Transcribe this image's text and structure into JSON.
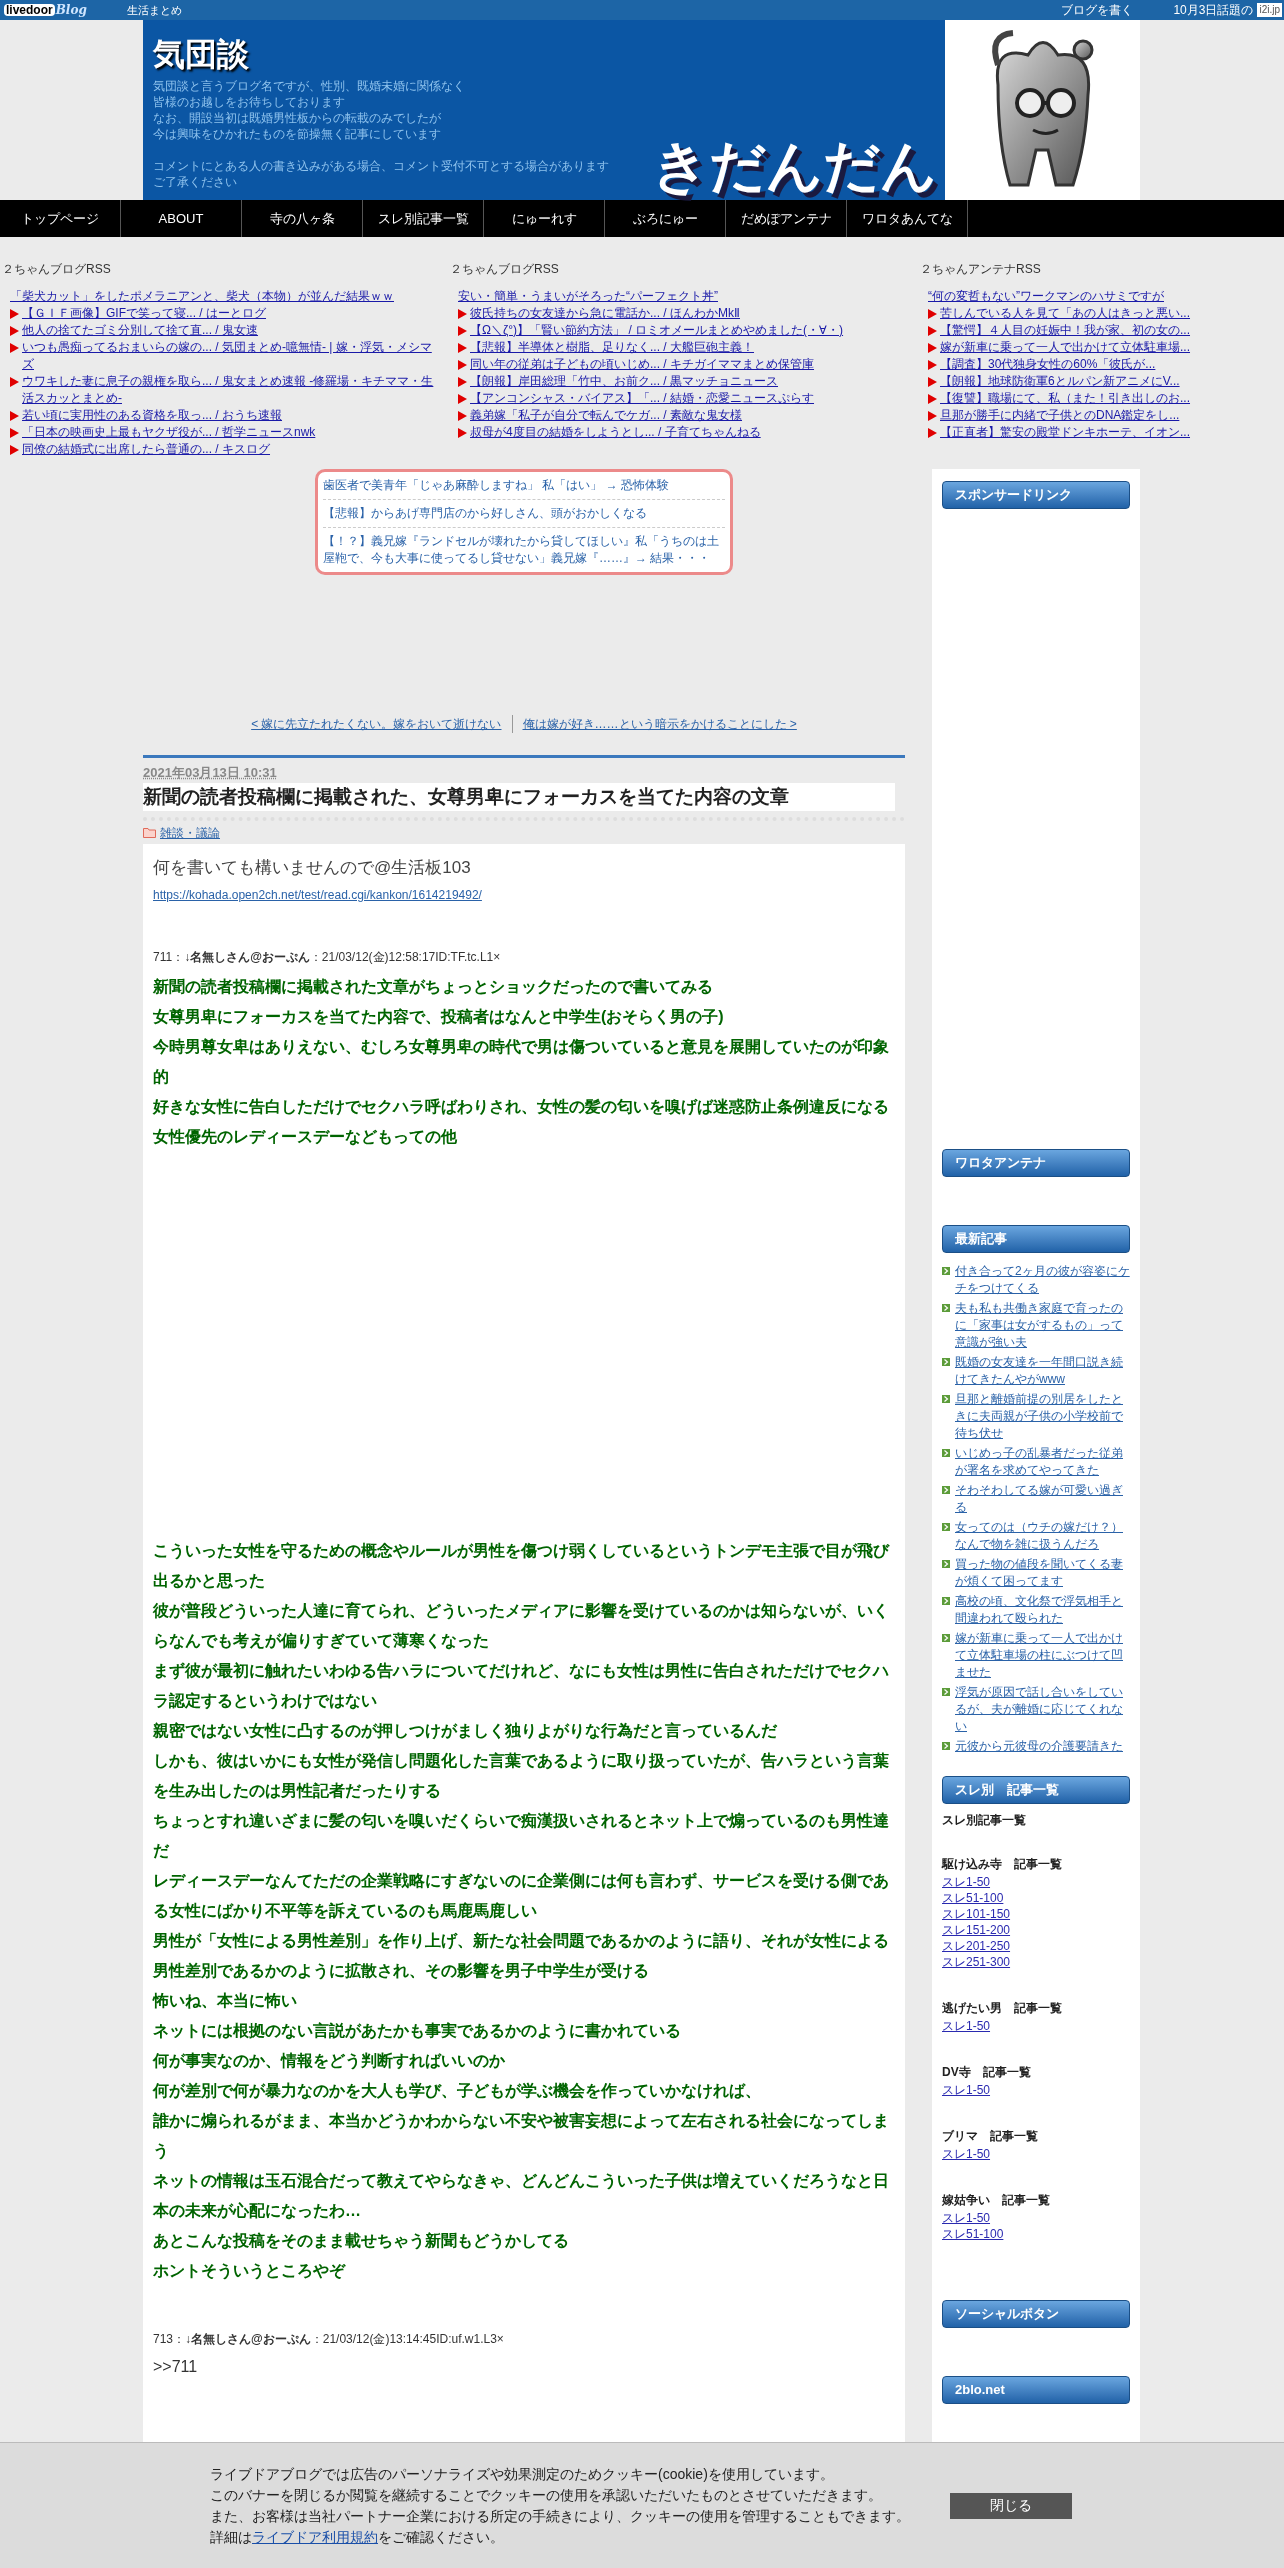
{
  "top_bar": {
    "logo": "livedoor",
    "logo_script": "Blog",
    "category": "生活まとめ",
    "links": [
      "ブログを書く",
      "10月3日話題の"
    ],
    "badge": "i2i.jp"
  },
  "header": {
    "title": "気団談",
    "description": [
      [
        "気団談と言うブログ名ですが、性別、既婚未婚に関係なく",
        "皆様のお越しをお待ちしております",
        "なお、開設当初は既婚男性板からの転載のみでしたが",
        "今は興味をひかれたものを節操無く記事にしています"
      ],
      [
        "コメントにとある人の書き込みがある場合、コメント受付不可とする場合があります",
        "ご了承ください"
      ]
    ],
    "banner_text": "きだんだん"
  },
  "nav": [
    "トップページ",
    "ABOUT",
    "寺の八ヶ条",
    "スレ別記事一覧",
    "にゅーれす",
    "ぶろにゅー",
    "だめぽアンテナ",
    "ワロタあんてな"
  ],
  "rss": [
    {
      "title": "２ちゃんブログRSS",
      "headline": "「柴犬カット」をしたポメラニアンと、柴犬（本物）が並んだ結果ｗｗ",
      "items": [
        "【ＧＩＦ画像】GIFで笑って寝... / はーとログ",
        "他人の捨てたゴミ分別して捨て直... / 鬼女速",
        "いつも愚痴ってるおまいらの嫁の... / 気団まとめ-噫無情- | 嫁・浮気・メシマズ",
        "ウワキした妻に息子の親権を取ら... / 鬼女まとめ速報 -修羅場・キチママ・生活スカッとまとめ-",
        "若い頃に実用性のある資格を取っ... / おうち速報",
        "「日本の映画史上最もヤクザ役が... / 哲学ニュースnwk",
        "同僚の結婚式に出席したら普通の... / キスログ"
      ]
    },
    {
      "title": "２ちゃんブログRSS",
      "headline": "安い・簡単・うまいがそろった“パーフェクト丼”",
      "items": [
        "彼氏持ちの女友達から急に電話か... / ほんわかMkⅡ",
        "【Ω＼ζ°)】「賢い節約方法」 / ロミオメールまとめやめました(・∀・)",
        "【悲報】半導体と樹脂、足りなく... / 大艦巨砲主義！",
        "同い年の従弟は子どもの頃いじめ... / キチガイママまとめ保管庫",
        "【朗報】岸田総理「竹中、お前ク... / 黒マッチョニュース",
        "【アンコンシャス・バイアス】「... / 結婚・恋愛ニュースぷらす",
        "義弟嫁「私子が自分で転んでケガ... / 素敵な鬼女様",
        "叔母が4度目の結婚をしようとし... / 子育てちゃんねる"
      ]
    },
    {
      "title": "２ちゃんアンテナRSS",
      "headline": "“何の変哲もない”ワークマンのハサミですが",
      "items": [
        "苦しんでいる人を見て「あの人はきっと悪い...",
        "【驚愕】４人目の妊娠中！我が家、初の女の...",
        "嫁が新車に乗って一人で出かけて立体駐車場...",
        "【調査】30代独身女性の60%「彼氏が...",
        "【朗報】地球防衛軍6とルパン新アニメにV...",
        "【復讐】職場にて、私（また！引き出しのお...",
        "旦那が勝手に内緒で子供とのDNA鑑定をし...",
        "【正直者】驚安の殿堂ドンキホーテ、イオン..."
      ]
    }
  ],
  "popular": [
    "歯医者で美青年「じゃあ麻酔しますね」 私「はい」 → 恐怖体験",
    "【悲報】からあげ専門店のから好しさん、頭がおかしくなる",
    "【！？】義兄嫁『ランドセルが壊れたから貸してほしい』私「うちのは土屋鞄で、今も大事に使ってるし貸せない」義兄嫁『……』→ 結果・・・"
  ],
  "post_nav": {
    "prev": "< 嫁に先立たれたくない。嫁をおいて逝けない",
    "next": "俺は嫁が好き……という暗示をかけることにした >"
  },
  "article": {
    "date": "2021年03月13日 10:31",
    "title": "新聞の読者投稿欄に掲載された、女尊男卑にフォーカスを当てた内容の文章",
    "category": "雑談・議論",
    "source": "何を書いても構いませんので@生活板103",
    "url": "https://kohada.open2ch.net/test/read.cgi/kankon/1614219492/",
    "posts": [
      {
        "meta": "711：**↓名無しさん@おーぷん**：21/03/12(金)12:58:17ID:TF.tc.L1×",
        "sections": [
          [
            "新聞の読者投稿欄に掲載された文章がちょっとショックだったので書いてみる",
            "女尊男卑にフォーカスを当てた内容で、投稿者はなんと中学生(おそらく男の子)",
            "今時男尊女卑はありえない、むしろ女尊男卑の時代で男は傷ついていると意見を展開していたのが印象的",
            "好きな女性に告白しただけでセクハラ呼ばわりされ、女性の髪の匂いを嗅げば迷惑防止条例違反になる",
            "女性優先のレディースデーなどもっての他"
          ],
          [
            "こういった女性を守るための概念やルールが男性を傷つけ弱くしているというトンデモ主張で目が飛び出るかと思った",
            "彼が普段どういった人達に育てられ、どういったメディアに影響を受けているのかは知らないが、いくらなんでも考えが偏りすぎていて薄寒くなった",
            "まず彼が最初に触れたいわゆる告ハラについてだけれど、なにも女性は男性に告白されただけでセクハラ認定するというわけではない",
            "親密ではない女性に凸するのが押しつけがましく独りよがりな行為だと言っているんだ",
            "しかも、彼はいかにも女性が発信し問題化した言葉であるように取り扱っていたが、告ハラという言葉を生み出したのは男性記者だったりする",
            "ちょっとすれ違いざまに髪の匂いを嗅いだくらいで痴漢扱いされるとネット上で煽っているのも男性達だ",
            "レディースデーなんてただの企業戦略にすぎないのに企業側には何も言わず、サービスを受ける側である女性にばかり不平等を訴えているのも馬鹿馬鹿しい",
            "男性が「女性による男性差別」を作り上げ、新たな社会問題であるかのように語り、それが女性による男性差別であるかのように拡散され、その影響を男子中学生が受ける",
            "怖いね、本当に怖い",
            "ネットには根拠のない言説があたかも事実であるかのように書かれている",
            "何が事実なのか、情報をどう判断すればいいのか",
            "何が差別で何が暴力なのかを大人も学び、子どもが学ぶ機会を作っていかなければ、",
            "誰かに煽られるがまま、本当かどうかわからない不安や被害妄想によって左右される社会になってしまう",
            "ネットの情報は玉石混合だって教えてやらなきゃ、どんどんこういった子供は増えていくだろうなと日本の未来が心配になったわ…",
            "あとこんな投稿をそのまま載せちゃう新聞もどうかしてる",
            "ホントそういうところやぞ"
          ]
        ]
      },
      {
        "meta": "713：**↓名無しさん@おーぷん**：21/03/12(金)13:14:45ID:uf.w1.L3×",
        "sections": [
          [
            ">>711"
          ]
        ]
      }
    ]
  },
  "sidebar": [
    {
      "kind": "ad",
      "heading": "スポンサードリンク"
    },
    {
      "kind": "empty",
      "heading": "ワロタアンテナ"
    },
    {
      "kind": "list",
      "heading": "最新記事",
      "items": [
        "付き合って2ヶ月の彼が容姿にケチをつけてくる",
        "夫も私も共働き家庭で育ったのに「家事は女がするもの」って意識が強い夫",
        "既婚の女友達を一年間口説き続けてきたんやがwww",
        "旦那と離婚前提の別居をしたときに夫両親が子供の小学校前で待ち伏せ",
        "いじめっ子の乱暴者だった従弟が署名を求めてやってきた",
        "そわそわしてる嫁が可愛い過ぎる",
        "女ってのは（ウチの嫁だけ？）なんで物を雑に扱うんだろ",
        "買った物の値段を聞いてくる妻が煩くて困ってます",
        "高校の頃、文化祭で浮気相手と間違われて殴られた",
        "嫁が新車に乗って一人で出かけて立体駐車場の柱にぶつけて凹ませた",
        "浮気が原因で話し合いをしているが、夫が離婚に応じてくれない",
        "元彼から元彼母の介護要請きた"
      ]
    },
    {
      "kind": "groups",
      "heading": "スレ別　記事一覧",
      "subtitle": "スレ別記事一覧",
      "groups": [
        {
          "title": "駆け込み寺　記事一覧",
          "links": [
            "スレ1-50",
            "スレ51-100",
            "スレ101-150",
            "スレ151-200",
            "スレ201-250",
            "スレ251-300"
          ]
        },
        {
          "title": "逃げたい男　記事一覧",
          "links": [
            "スレ1-50"
          ]
        },
        {
          "title": "DV寺　記事一覧",
          "links": [
            "スレ1-50"
          ]
        },
        {
          "title": "ブリマ　記事一覧",
          "links": [
            "スレ1-50"
          ]
        },
        {
          "title": "嫁姑争い　記事一覧",
          "links": [
            "スレ1-50",
            "スレ51-100"
          ]
        }
      ]
    },
    {
      "kind": "empty",
      "heading": "ソーシャルボタン"
    },
    {
      "kind": "last",
      "heading": "2blo.net"
    }
  ],
  "cookie_banner": {
    "lines": [
      "ライブドアブログでは広告のパーソナライズや効果測定のためクッキー(cookie)を使用しています。",
      "このバナーを閉じるか閲覧を継続することでクッキーの使用を承認いただいたものとさせていただきます。",
      "また、お客様は当社パートナー企業における所定の手続きにより、クッキーの使用を管理することもできます。"
    ],
    "detail_before": "詳細は",
    "detail_link": "ライブドア利用規約",
    "detail_after": "をご確認ください。",
    "button": "閉じる"
  }
}
